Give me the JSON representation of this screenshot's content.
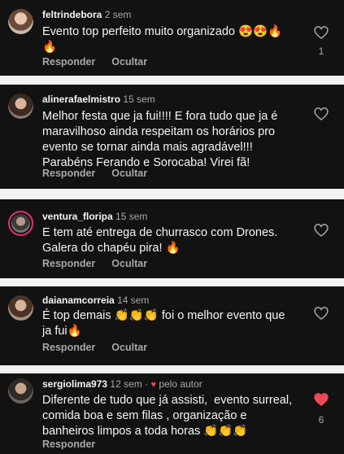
{
  "comments": [
    {
      "username": "feltrindebora",
      "time": "2 sem",
      "text": "Evento top perfeito muito organizado 😍😍🔥🔥",
      "reply_label": "Responder",
      "hide_label": "Ocultar",
      "likes": "1",
      "liked": false
    },
    {
      "username": "alinerafaelmistro",
      "time": "15 sem",
      "text": "Melhor festa que ja fui!!!! E fora tudo que ja é maravilhoso ainda respeitam os horários pro evento se tornar ainda mais agradável!!! Parabéns Ferando e Sorocaba! Virei fã!",
      "reply_label": "Responder",
      "hide_label": "Ocultar",
      "likes": "",
      "liked": false
    },
    {
      "username": "ventura_floripa",
      "time": "15 sem",
      "text": "E tem até entrega de churrasco com Drones. Galera do chapéu pira! 🔥",
      "reply_label": "Responder",
      "hide_label": "Ocultar",
      "likes": "",
      "liked": false
    },
    {
      "username": "daianamcorreia",
      "time": "14 sem",
      "text": "É top demais 👏👏👏 foi o melhor evento que ja fui🔥",
      "reply_label": "Responder",
      "hide_label": "Ocultar",
      "likes": "",
      "liked": false
    },
    {
      "username": "sergiolima973",
      "time": "12 sem",
      "author_label": "pelo autor",
      "text": "Diferente de tudo que já assisti,  evento surreal, comida boa e sem filas , organização e banheiros limpos a toda horas 👏👏👏",
      "reply_label": "Responder",
      "hide_label": "",
      "likes": "6",
      "liked": true
    }
  ],
  "colors": {
    "background": "#121212",
    "separator": "#f2f2f2",
    "primary_text": "#f5f5f5",
    "secondary_text": "#a8a8a8",
    "like_red": "#ed4956"
  }
}
